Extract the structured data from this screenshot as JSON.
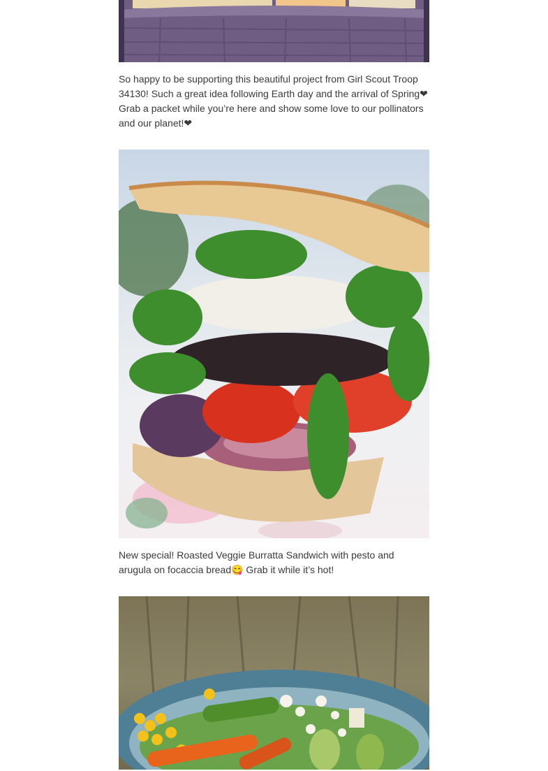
{
  "posts": [
    {
      "image_alt": "basket photo",
      "caption": "So happy to be supporting this beautiful project from Girl Scout Troop 34130! Such a great idea following Earth day and the arrival of Spring❤ Grab a packet while you’re here and show some love to our pollinators and our planet!❤"
    },
    {
      "image_alt": "roasted veggie burrata sandwich photo",
      "caption": "New special! Roasted Veggie Burratta Sandwich with pesto and arugula on focaccia bread😋 Grab it while it’s hot!"
    },
    {
      "image_alt": "salad bowl photo",
      "caption": ""
    }
  ]
}
